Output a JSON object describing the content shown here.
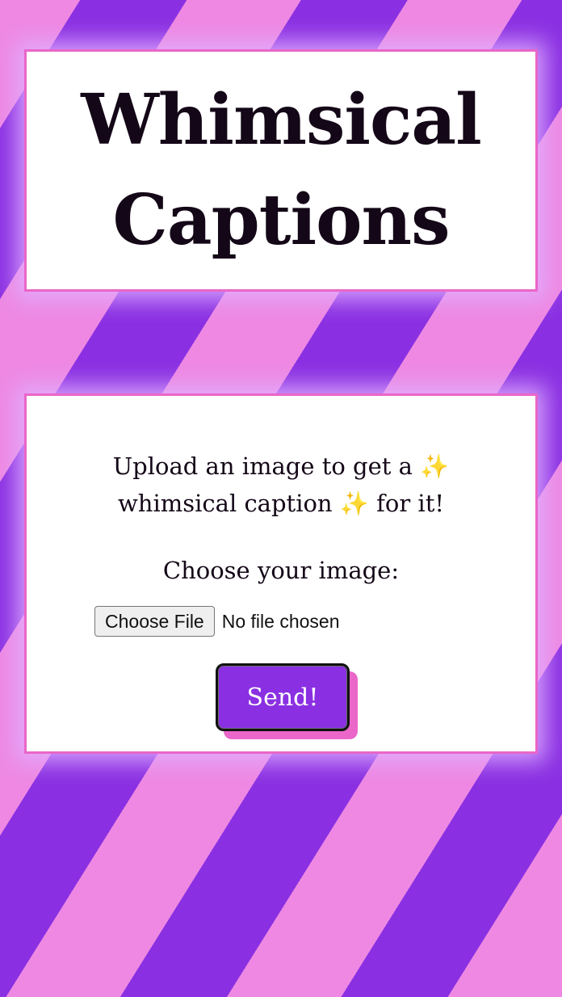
{
  "header": {
    "title_line1": "Whimsical",
    "title_line2": "Captions"
  },
  "form": {
    "intro_line1": "Upload an image to get a ✨",
    "intro_line2": "whimsical caption ✨ for it!",
    "choose_label": "Choose your image:",
    "file_button_label": "Choose File",
    "file_status": "No file chosen",
    "send_label": "Send!"
  },
  "colors": {
    "stripe_pink": "#ee88e3",
    "stripe_purple": "#8a30e2",
    "card_border": "#ea66c8",
    "button_bg": "#8a30e2",
    "title_text": "#140717"
  }
}
